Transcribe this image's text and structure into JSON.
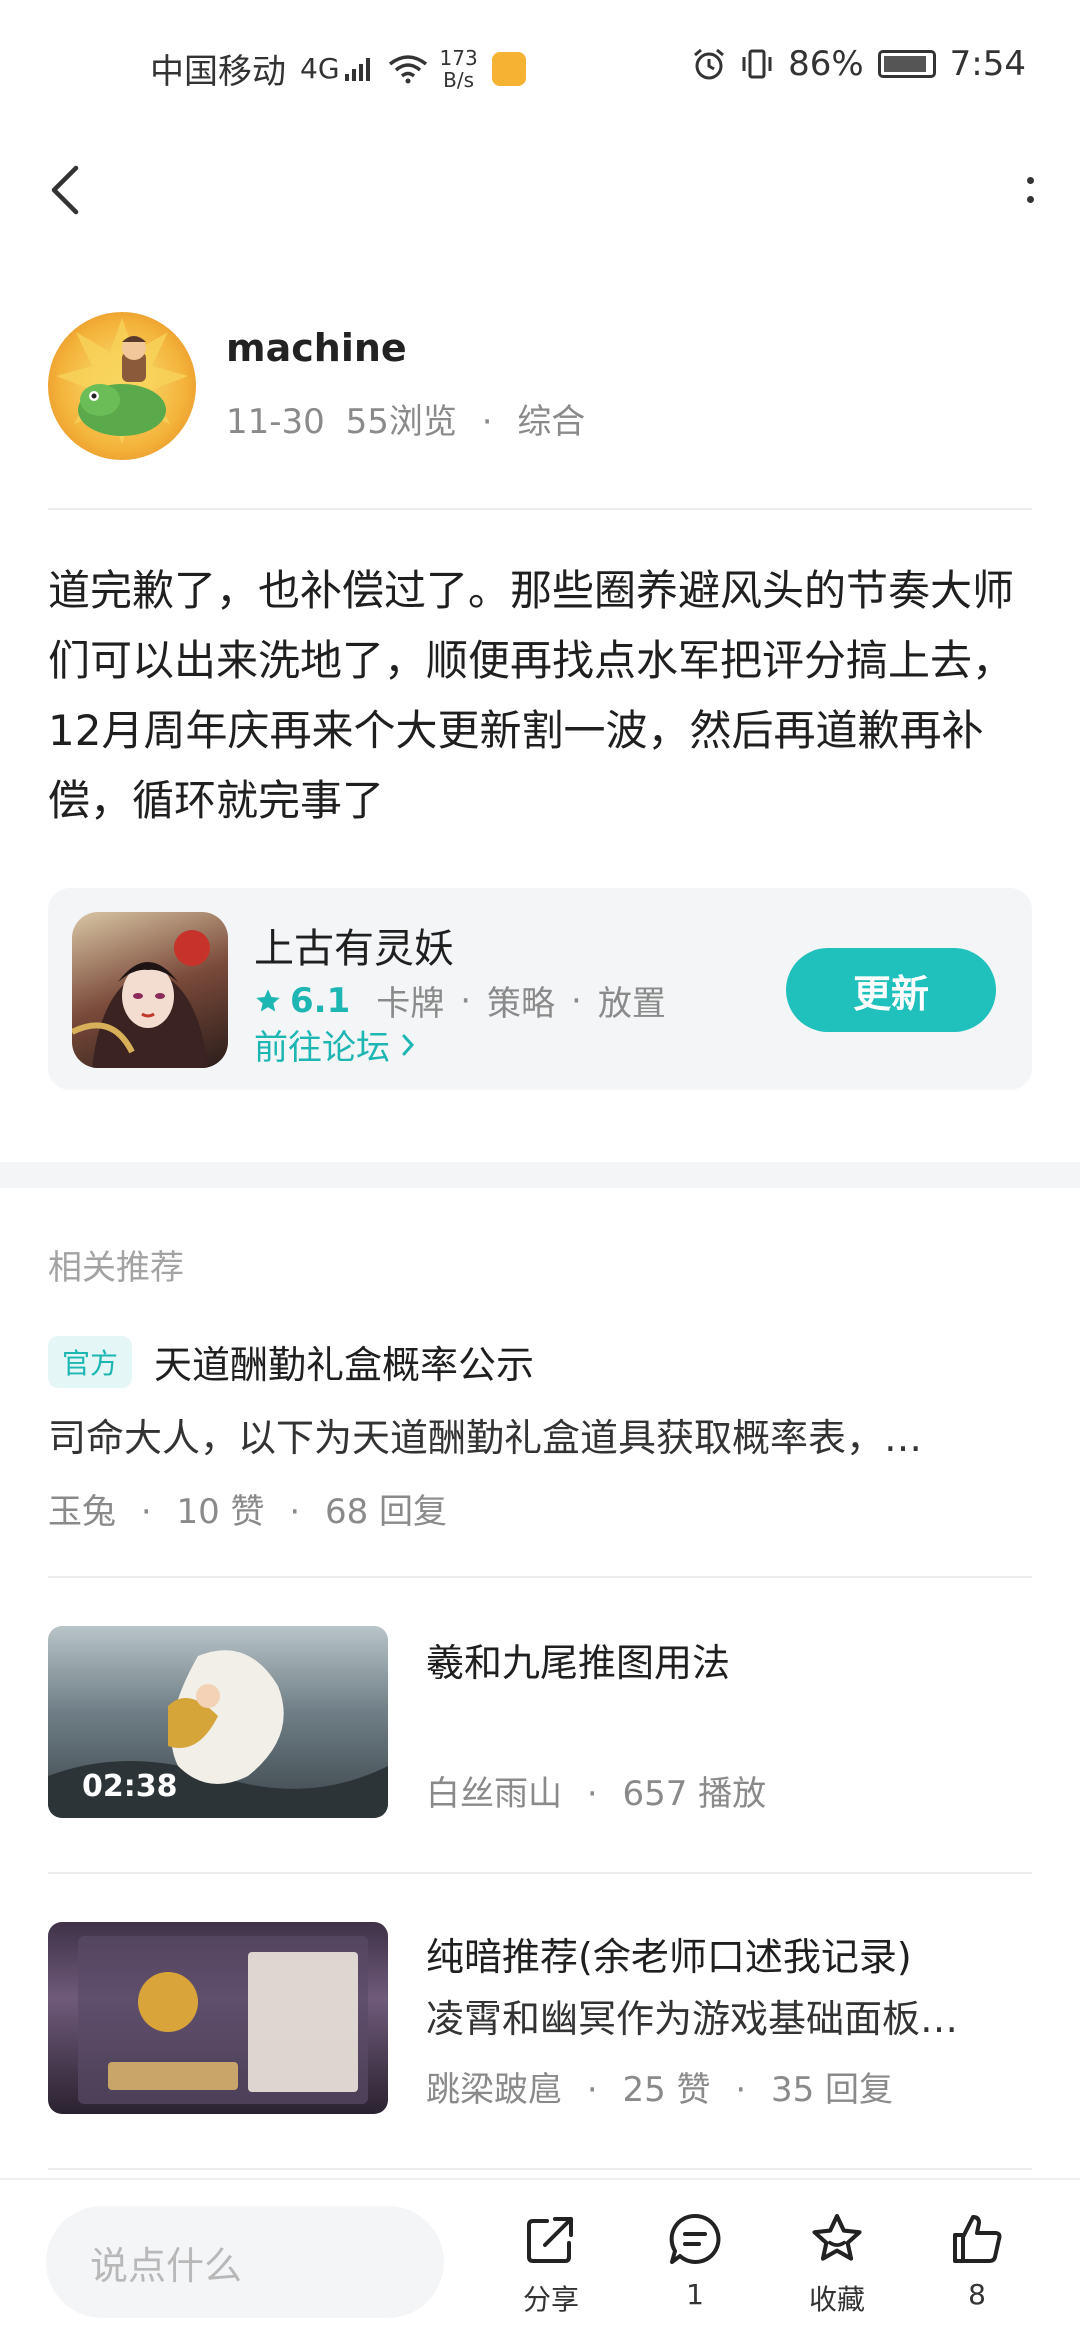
{
  "status_bar": {
    "carrier": "中国移动",
    "network": "4G",
    "speed_value": "173",
    "speed_unit": "B/s",
    "battery": "86%",
    "time": "7:54"
  },
  "post": {
    "author": {
      "name": "machine",
      "date": "11-30",
      "views": "55浏览",
      "category": "综合"
    },
    "body": "道完歉了，也补偿过了。那些圈养避风头的节奏大师们可以出来洗地了，顺便再找点水军把评分搞上去，12月周年庆再来个大更新割一波，然后再道歉再补偿，循环就完事了"
  },
  "game_card": {
    "name": "上古有灵妖",
    "rating": "6.1",
    "tags": [
      "卡牌",
      "策略",
      "放置"
    ],
    "forum_link": "前往论坛",
    "button": "更新",
    "accent_color": "#20c0bc"
  },
  "recommend": {
    "section_title": "相关推荐",
    "items": [
      {
        "badge": "官方",
        "title": "天道酬勤礼盒概率公示",
        "desc": "司命大人，以下为天道酬勤礼盒道具获取概率表，…",
        "author": "玉兔",
        "likes": "10 赞",
        "replies": "68 回复"
      },
      {
        "title": "羲和九尾推图用法",
        "duration": "02:38",
        "author": "白丝雨山",
        "plays": "657 播放"
      },
      {
        "title": "纯暗推荐(余老师口述我记录)",
        "desc": "凌霄和幽冥作为游戏基础面板…",
        "author": "跳梁跛扈",
        "likes": "25 赞",
        "replies": "35 回复"
      }
    ]
  },
  "bottom_bar": {
    "comment_placeholder": "说点什么",
    "share_label": "分享",
    "comment_count": "1",
    "favorite_label": "收藏",
    "like_count": "8"
  }
}
